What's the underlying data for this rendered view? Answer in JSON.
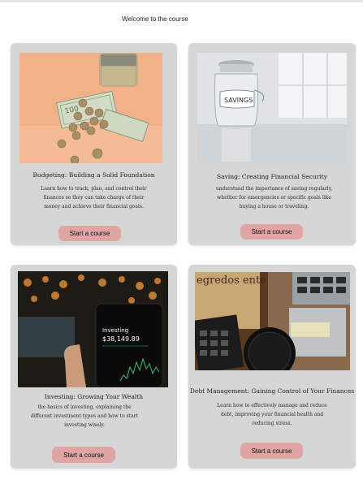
{
  "header": {
    "welcome": "Welcome to the course"
  },
  "cards": [
    {
      "title": "Budgeting: Building a Solid Foundation",
      "description": "Learn how to track, plan, and control their finances so they can take charge of their money and achieve their financial goals.",
      "button": "Start a course",
      "image": "money-coins-photo"
    },
    {
      "title": "Saving: Creating Financial Security",
      "description": "understand the importance of saving regularly, whether for emergencies or specific goals like buying a house or traveling.",
      "button": "Start a course",
      "image": "savings-jar-photo",
      "jar_label": "SAVINGS"
    },
    {
      "title": "Investing: Growing Your Wealth",
      "description": "the basics of investing, explaining the different investment types and how to start investing wisely.",
      "button": "Start a course",
      "image": "phone-investing-photo",
      "phone_label": "Investing",
      "phone_value": "$38,149.89"
    },
    {
      "title": "Debt Management: Gaining Control of Your Finances",
      "description": "Learn how to effectively manage and reduce debt, improving your financial health and reducing stress.",
      "button": "Start a course",
      "image": "calculator-desk-photo",
      "book_text": "egredos ente nária"
    }
  ]
}
